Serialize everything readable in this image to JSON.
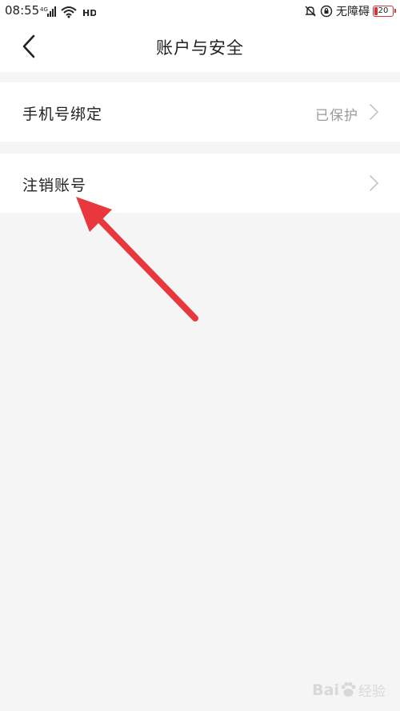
{
  "status_bar": {
    "time": "08:55",
    "network": "4G",
    "hd": "HD",
    "accessibility": "无障碍",
    "battery": "20",
    "battery_color": "#d4323a"
  },
  "nav": {
    "back_icon": "chevron-left-icon",
    "title": "账户与安全"
  },
  "settings": {
    "items": [
      {
        "label": "手机号绑定",
        "value": "已保护",
        "icon": "chevron-right-icon"
      },
      {
        "label": "注销账号",
        "value": "",
        "icon": "chevron-right-icon"
      }
    ]
  },
  "annotation": {
    "arrow_color": "#e8383d"
  },
  "watermark": {
    "logo_text": "Bai",
    "suffix_text": "经验"
  }
}
